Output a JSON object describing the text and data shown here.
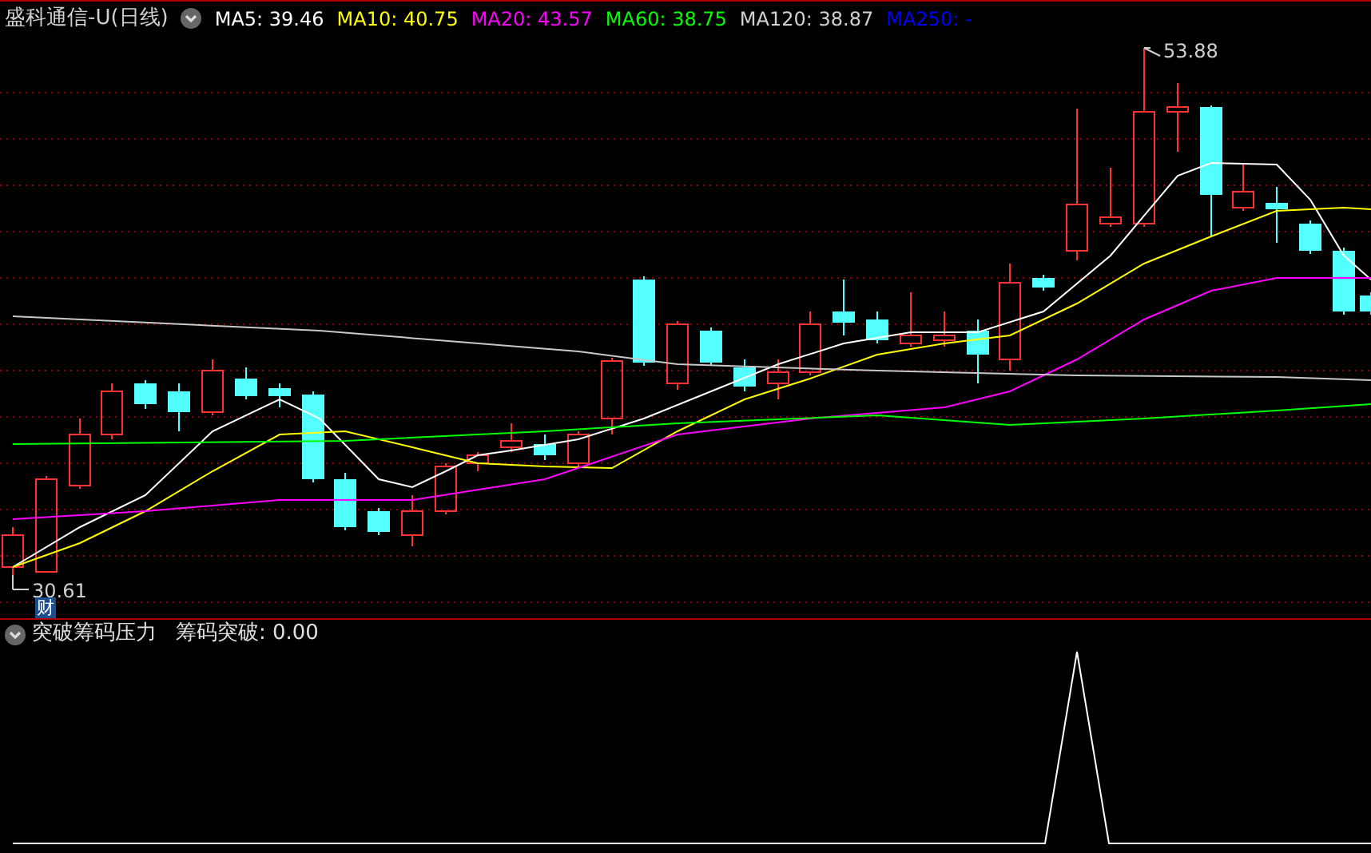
{
  "header": {
    "title": "盛科通信-U(日线)",
    "ma": [
      {
        "label": "MA5: 39.46",
        "color": "#ffffff"
      },
      {
        "label": "MA10: 40.75",
        "color": "#ffff00"
      },
      {
        "label": "MA20: 43.57",
        "color": "#ff00ff"
      },
      {
        "label": "MA60: 38.75",
        "color": "#00ff00"
      },
      {
        "label": "MA120: 38.87",
        "color": "#d0d0d0"
      },
      {
        "label": "MA250: -",
        "color": "#0000ff"
      }
    ]
  },
  "price_chart": {
    "high_label": "53.88",
    "low_label": "30.61",
    "badge": "财"
  },
  "indicator": {
    "title": "突破筹码压力",
    "reading": "筹码突破: 0.00"
  }
}
